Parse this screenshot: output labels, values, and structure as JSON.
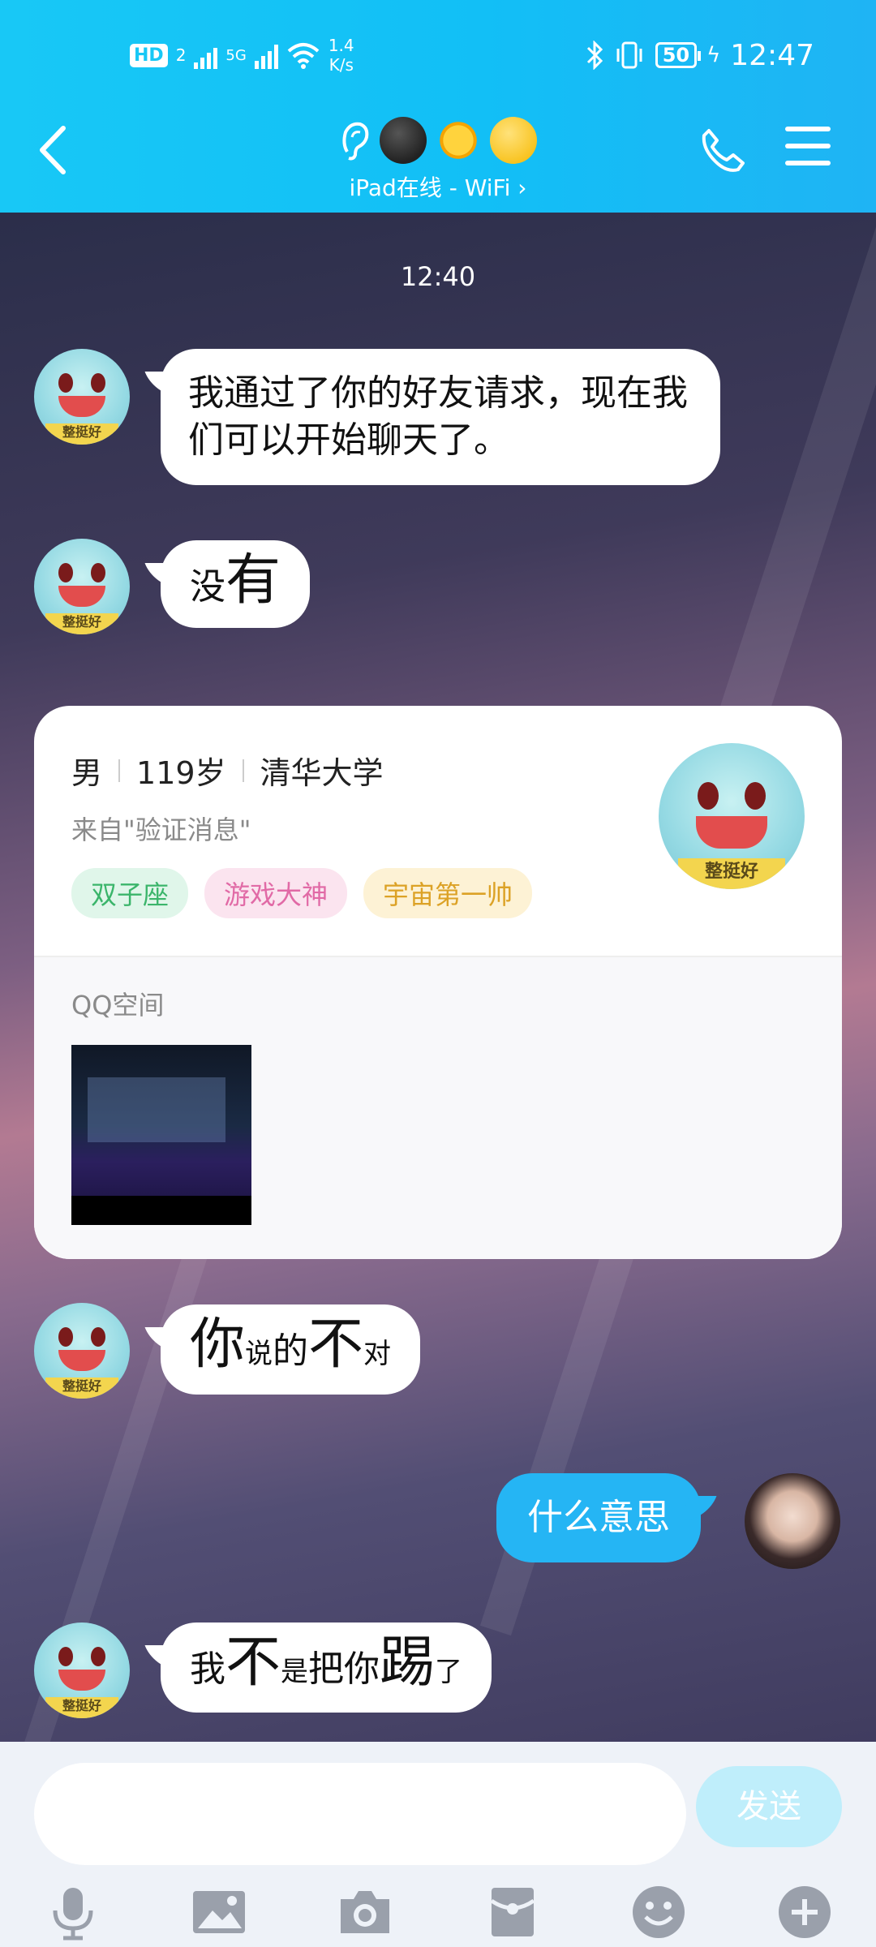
{
  "status_bar": {
    "hd": "HD",
    "sim_index": "2",
    "network": "5G",
    "speed_value": "1.4",
    "speed_unit": "K/s",
    "battery": "50",
    "time": "12:47"
  },
  "header": {
    "online_status": "iPad在线 - WiFi ›",
    "title_icons": [
      "ear-icon",
      "moon-face-icon",
      "sun-face-icon",
      "smirk-face-icon"
    ]
  },
  "chat": {
    "timestamp": "12:40",
    "messages": [
      {
        "side": "left",
        "text": "我通过了你的好友请求，现在我们可以开始聊天了。"
      },
      {
        "side": "left",
        "parts": [
          "没",
          "有"
        ]
      },
      {
        "side": "left",
        "parts": [
          "你",
          "说",
          "的",
          "不",
          "对"
        ]
      },
      {
        "side": "right",
        "text": "什么意思"
      },
      {
        "side": "left",
        "parts": [
          "我",
          "不",
          "是",
          "把",
          "你",
          "踢",
          "了"
        ]
      }
    ],
    "avatar_caption": "整挺好"
  },
  "profile_card": {
    "gender": "男",
    "age": "119岁",
    "school": "清华大学",
    "source": "来自\"验证消息\"",
    "tags": [
      "双子座",
      "游戏大神",
      "宇宙第一帅"
    ],
    "qzone_label": "QQ空间"
  },
  "input": {
    "placeholder": "",
    "send_label": "发送"
  },
  "toolbar_icons": [
    "microphone-icon",
    "image-icon",
    "camera-icon",
    "red-packet-icon",
    "emoji-icon",
    "plus-icon"
  ],
  "colors": {
    "header": "#18c8f6",
    "outgoing_bubble": "#25b5f4",
    "send_button": "#bfeefb"
  }
}
